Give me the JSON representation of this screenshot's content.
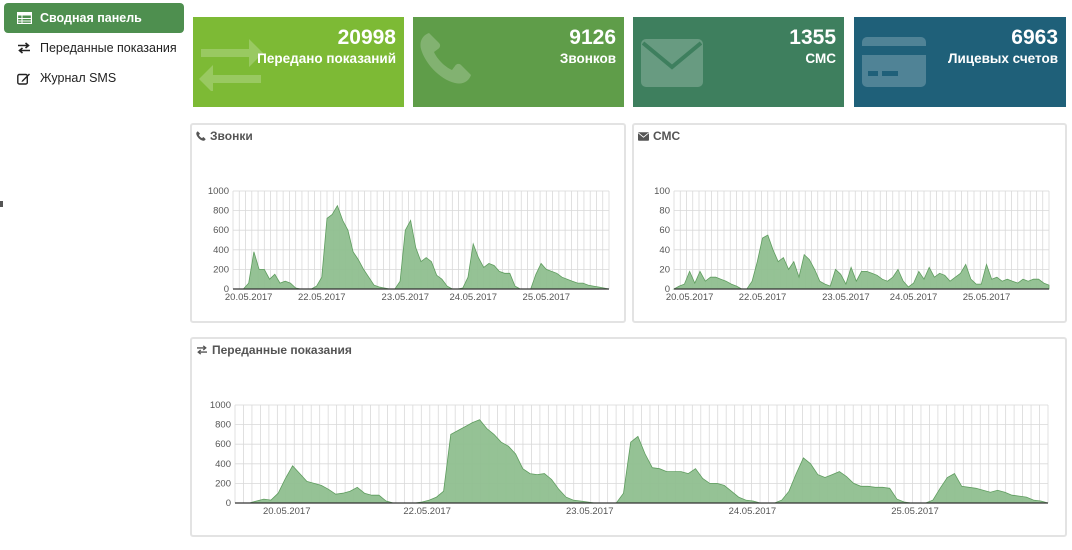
{
  "sidebar": {
    "items": [
      {
        "label": "Сводная панель",
        "icon": "table-icon",
        "active": true
      },
      {
        "label": "Переданные показания",
        "icon": "exchange-arrows-icon",
        "active": false
      },
      {
        "label": "Журнал SMS",
        "icon": "edit-icon",
        "active": false
      }
    ]
  },
  "tiles": [
    {
      "value": "20998",
      "label": "Передано показаний",
      "icon": "exchange-arrows-icon",
      "color": "#7dba35"
    },
    {
      "value": "9126",
      "label": "Звонков",
      "icon": "phone-icon",
      "color": "#5f9d49"
    },
    {
      "value": "1355",
      "label": "СМС",
      "icon": "envelope-icon",
      "color": "#3e7f5e"
    },
    {
      "value": "6963",
      "label": "Лицевых счетов",
      "icon": "credit-card-icon",
      "color": "#1f6079"
    }
  ],
  "panels": {
    "calls": {
      "title": "Звонки",
      "icon": "phone-icon"
    },
    "sms": {
      "title": "СМС",
      "icon": "envelope-icon"
    },
    "readings": {
      "title": "Переданные показания",
      "icon": "exchange-arrows-icon"
    }
  },
  "colors": {
    "area_fill": "#8fbf8f",
    "area_stroke": "#5f9d5f",
    "grid": "#d9d9d9",
    "axis": "#333333"
  },
  "chart_data": [
    {
      "id": "calls",
      "type": "area",
      "title": "Звонки",
      "ylim": [
        0,
        1000
      ],
      "yticks": [
        0,
        200,
        400,
        600,
        800,
        1000
      ],
      "xlim": [
        0,
        72
      ],
      "xticks": [
        {
          "x": 3,
          "label": "20.05.2017"
        },
        {
          "x": 17,
          "label": "22.05.2017"
        },
        {
          "x": 33,
          "label": "23.05.2017"
        },
        {
          "x": 46,
          "label": "24.05.2017"
        },
        {
          "x": 60,
          "label": "25.05.2017"
        }
      ],
      "grid": true,
      "values": [
        0,
        0,
        0,
        60,
        380,
        200,
        200,
        100,
        150,
        60,
        80,
        60,
        10,
        0,
        0,
        0,
        30,
        120,
        720,
        760,
        850,
        700,
        600,
        380,
        300,
        200,
        120,
        40,
        20,
        10,
        0,
        0,
        80,
        600,
        700,
        420,
        280,
        320,
        280,
        140,
        100,
        30,
        0,
        0,
        10,
        120,
        460,
        320,
        220,
        260,
        240,
        180,
        160,
        160,
        30,
        0,
        0,
        0,
        150,
        260,
        200,
        180,
        160,
        120,
        100,
        80,
        60,
        60,
        40,
        30,
        20,
        10,
        0
      ]
    },
    {
      "id": "sms",
      "type": "area",
      "title": "СМС",
      "ylim": [
        0,
        100
      ],
      "yticks": [
        0,
        20,
        40,
        60,
        80,
        100
      ],
      "xlim": [
        0,
        72
      ],
      "xticks": [
        {
          "x": 3,
          "label": "20.05.2017"
        },
        {
          "x": 17,
          "label": "22.05.2017"
        },
        {
          "x": 33,
          "label": "23.05.2017"
        },
        {
          "x": 46,
          "label": "24.05.2017"
        },
        {
          "x": 60,
          "label": "25.05.2017"
        }
      ],
      "grid": true,
      "values": [
        0,
        3,
        5,
        18,
        6,
        18,
        8,
        12,
        12,
        10,
        8,
        5,
        3,
        0,
        0,
        8,
        28,
        52,
        55,
        40,
        28,
        32,
        20,
        28,
        12,
        35,
        30,
        20,
        8,
        5,
        3,
        20,
        15,
        5,
        22,
        8,
        18,
        18,
        16,
        14,
        10,
        8,
        12,
        20,
        8,
        2,
        6,
        18,
        10,
        22,
        12,
        16,
        14,
        8,
        12,
        16,
        25,
        10,
        5,
        5,
        25,
        10,
        12,
        8,
        10,
        8,
        6,
        10,
        8,
        10,
        10,
        6,
        4
      ]
    },
    {
      "id": "readings",
      "type": "area",
      "title": "Переданные показания",
      "ylim": [
        0,
        1000
      ],
      "yticks": [
        0,
        200,
        400,
        600,
        800,
        1000
      ],
      "xlim": [
        0,
        110
      ],
      "xticks": [
        {
          "x": 7,
          "label": "20.05.2017"
        },
        {
          "x": 26,
          "label": "22.05.2017"
        },
        {
          "x": 48,
          "label": "23.05.2017"
        },
        {
          "x": 70,
          "label": "24.05.2017"
        },
        {
          "x": 92,
          "label": "25.05.2017"
        }
      ],
      "grid": true,
      "values": [
        0,
        0,
        0,
        20,
        40,
        30,
        100,
        250,
        380,
        300,
        220,
        200,
        180,
        140,
        90,
        100,
        120,
        160,
        100,
        80,
        80,
        20,
        0,
        0,
        0,
        0,
        10,
        30,
        60,
        120,
        700,
        740,
        780,
        820,
        850,
        760,
        700,
        620,
        580,
        500,
        350,
        300,
        290,
        300,
        240,
        140,
        60,
        30,
        20,
        10,
        0,
        0,
        0,
        0,
        100,
        620,
        680,
        500,
        360,
        350,
        320,
        320,
        320,
        300,
        350,
        250,
        200,
        200,
        180,
        120,
        60,
        30,
        20,
        0,
        0,
        0,
        30,
        120,
        300,
        460,
        400,
        290,
        260,
        290,
        320,
        270,
        200,
        170,
        170,
        160,
        160,
        150,
        40,
        10,
        0,
        0,
        0,
        30,
        150,
        260,
        300,
        170,
        160,
        150,
        130,
        110,
        130,
        110,
        80,
        70,
        60,
        30,
        20,
        0
      ]
    }
  ]
}
